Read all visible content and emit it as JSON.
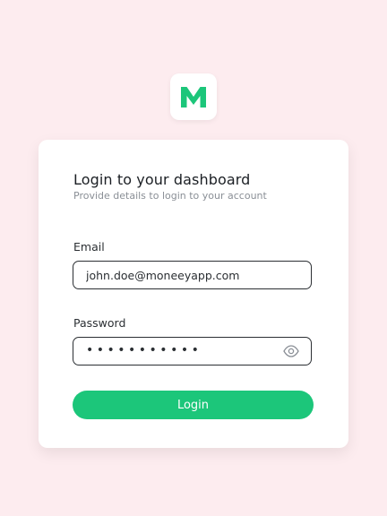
{
  "brand": {
    "logo_letter": "M",
    "logo_icon": "m-logo-icon",
    "accent_color": "#1cc67a",
    "background_color": "#fdecef"
  },
  "login": {
    "title": "Login to your dashboard",
    "subtitle": "Provide details to login to your account",
    "email": {
      "label": "Email",
      "value": "john.doe@moneeyapp.com"
    },
    "password": {
      "label": "Password",
      "masked_value": "•••••••••••",
      "toggle_icon": "eye-icon"
    },
    "submit_label": "Login"
  }
}
